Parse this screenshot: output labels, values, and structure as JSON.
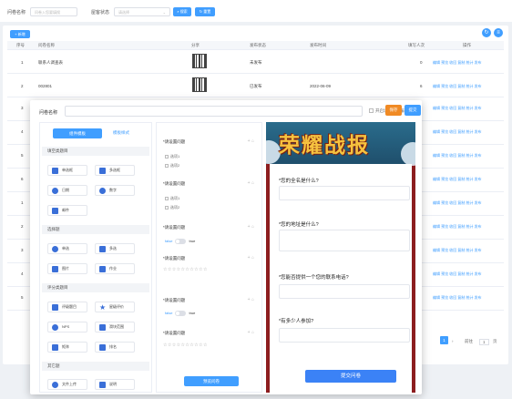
{
  "toolbar": {
    "name_label": "问卷名称",
    "name_placeholder": "问卷入您要填搜",
    "status_label": "屋客状态",
    "status_placeholder": "请选择",
    "search_btn": "搜索",
    "reset_btn": "重置"
  },
  "list": {
    "add_btn": "+ 新增",
    "columns": [
      "序号",
      "问卷名称",
      "分享",
      "发布状态",
      "发布时间",
      "填写人次",
      "操作"
    ],
    "rows": [
      {
        "no": "1",
        "name": "联系人调查表",
        "status": "未发布",
        "time": "",
        "count": "0",
        "ops": "编辑 预览 收回 复制 统计 发布"
      },
      {
        "no": "2",
        "name": "002801",
        "status": "已发布",
        "time": "2022-06-09",
        "count": "6",
        "ops": "编辑 预览 收回 复制 统计 发布"
      },
      {
        "no": "3",
        "ops": "编辑 预览 收回 复制 统计 发布"
      },
      {
        "no": "4",
        "ops": "编辑 预览 收回 复制 统计 发布"
      },
      {
        "no": "5",
        "ops": "编辑 预览 收回 复制 统计 发布"
      },
      {
        "no": "6",
        "ops": "编辑 预览 收回 复制 统计 发布"
      },
      {
        "no": "1",
        "ops": "编辑 预览 收回 复制 统计 发布"
      },
      {
        "no": "2",
        "ops": "编辑 预览 收回 复制 统计 发布"
      },
      {
        "no": "3",
        "ops": "编辑 预览 收回 复制 统计 发布"
      },
      {
        "no": "4",
        "ops": "编辑 预览 收回 复制 统计 发布"
      },
      {
        "no": "5",
        "ops": "编辑 预览 收回 复制 统计 发布"
      }
    ],
    "pager": {
      "current": "1",
      "goto_label": "前往",
      "goto_value": "1",
      "page_unit": "页"
    }
  },
  "dialog": {
    "name_label": "问卷名称",
    "allow_edit_label": "开启填写后可编辑",
    "save_btn": "保存",
    "submit_btn": "提交"
  },
  "palette": {
    "tab_active": "组件模板",
    "tab_inactive": "模板样式",
    "sections": [
      {
        "title": "填空类题目",
        "items": [
          "单选框",
          "多选框",
          "日期",
          "数字",
          "邮件"
        ]
      },
      {
        "title": "选择题",
        "items": [
          "单选",
          "多选",
          "图片",
          "作业"
        ]
      },
      {
        "title": "评分类题目",
        "items": [
          "评级题目",
          "星级评价",
          "NPS",
          "滑块范围",
          "矩阵",
          "排名"
        ]
      },
      {
        "title": "其它题",
        "items": [
          "文件上传",
          "说明"
        ]
      }
    ]
  },
  "form": {
    "questions": [
      {
        "title": "*请设置问题",
        "options": [
          "选项1",
          "选项2"
        ]
      },
      {
        "title": "*请设置问题",
        "options": [
          "选项1",
          "选项2"
        ]
      },
      {
        "title": "*请设置问题",
        "false": "false",
        "true": "true"
      },
      {
        "title": "*请设置问题",
        "stars": "☆☆☆☆☆☆☆☆☆☆"
      },
      {
        "title": "*请设置问题",
        "false": "false",
        "true": "true"
      },
      {
        "title": "*请设置问题",
        "stars": "☆☆☆☆☆☆☆☆☆☆"
      }
    ],
    "preview_btn": "预览问卷"
  },
  "preview": {
    "banner": "荣耀战报",
    "questions": [
      "*您的全名是什么?",
      "*您的地址是什么?",
      "*您能否提供一个您的联系电话?",
      "*有多少人参加?"
    ],
    "submit_btn": "提交问卷"
  }
}
